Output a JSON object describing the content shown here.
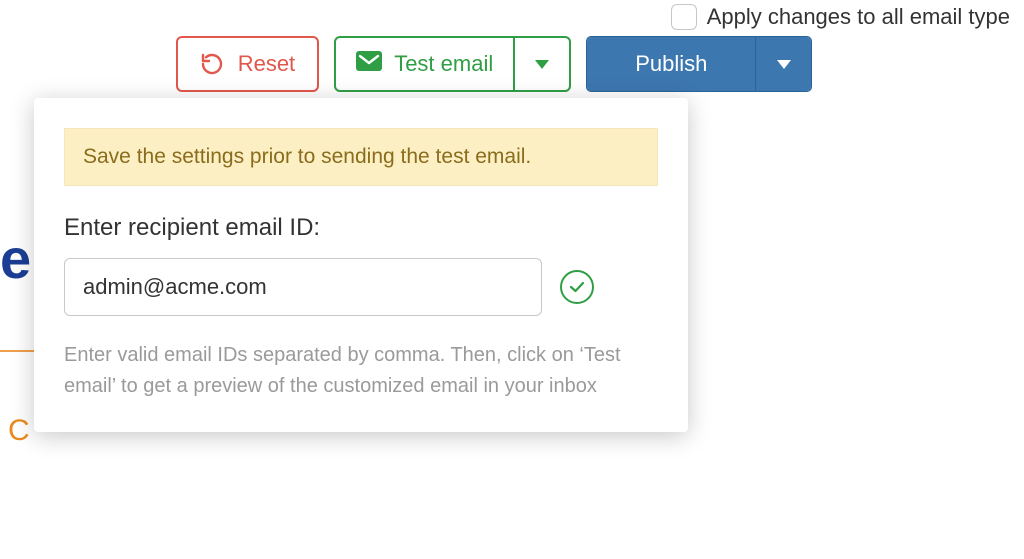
{
  "toolbar": {
    "apply_all_label": "Apply changes to all email type",
    "reset_label": "Reset",
    "test_email_label": "Test email",
    "publish_label": "Publish"
  },
  "panel": {
    "warning_text": "Save the settings prior to sending the test email.",
    "prompt_label": "Enter recipient email ID:",
    "email_value": "admin@acme.com",
    "hint_text": "Enter valid email IDs separated by comma. Then, click on ‘Test email’ to get a preview of the customized email in your inbox"
  },
  "background": {
    "blue_fragment": "e",
    "orange_fragment": "C"
  }
}
